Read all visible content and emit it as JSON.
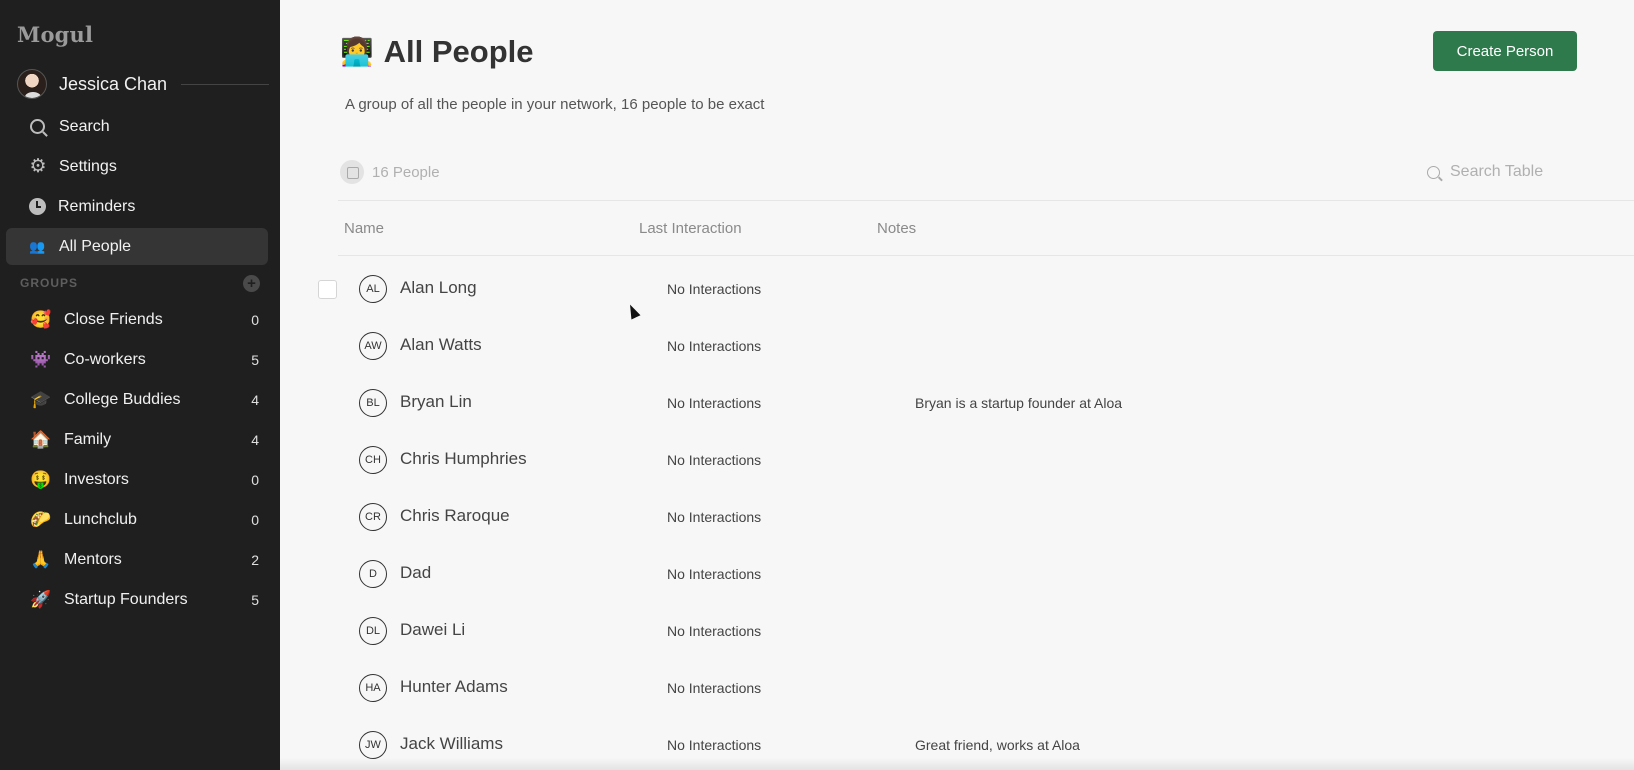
{
  "sidebar": {
    "brand": "Mogul",
    "user_name": "Jessica Chan",
    "nav": [
      {
        "label": "Search",
        "icon": "search-icon"
      },
      {
        "label": "Settings",
        "icon": "gear-icon"
      },
      {
        "label": "Reminders",
        "icon": "clock-icon"
      },
      {
        "label": "All People",
        "icon": "people-icon",
        "active": true
      }
    ],
    "groups_title": "GROUPS",
    "groups": [
      {
        "emoji": "🥰",
        "label": "Close Friends",
        "count": "0"
      },
      {
        "emoji": "👾",
        "label": "Co-workers",
        "count": "5"
      },
      {
        "emoji": "🎓",
        "label": "College Buddies",
        "count": "4"
      },
      {
        "emoji": "🏠",
        "label": "Family",
        "count": "4"
      },
      {
        "emoji": "🤑",
        "label": "Investors",
        "count": "0"
      },
      {
        "emoji": "🌮",
        "label": "Lunchclub",
        "count": "0"
      },
      {
        "emoji": "🙏",
        "label": "Mentors",
        "count": "2"
      },
      {
        "emoji": "🚀",
        "label": "Startup Founders",
        "count": "5"
      }
    ]
  },
  "main": {
    "title_emoji": "👩‍💻",
    "title": "All People",
    "description": "A group of all the people in your network, 16 people to be exact",
    "create_button": "Create Person",
    "count_label": "16 People",
    "search_placeholder": "Search Table",
    "columns": {
      "name": "Name",
      "last_interaction": "Last Interaction",
      "notes": "Notes"
    },
    "rows": [
      {
        "initials": "AL",
        "name": "Alan Long",
        "last_interaction": "No Interactions",
        "notes": ""
      },
      {
        "initials": "AW",
        "name": "Alan Watts",
        "last_interaction": "No Interactions",
        "notes": ""
      },
      {
        "initials": "BL",
        "name": "Bryan Lin",
        "last_interaction": "No Interactions",
        "notes": "Bryan is a startup founder at Aloa"
      },
      {
        "initials": "CH",
        "name": "Chris Humphries",
        "last_interaction": "No Interactions",
        "notes": ""
      },
      {
        "initials": "CR",
        "name": "Chris Raroque",
        "last_interaction": "No Interactions",
        "notes": ""
      },
      {
        "initials": "D",
        "name": "Dad",
        "last_interaction": "No Interactions",
        "notes": ""
      },
      {
        "initials": "DL",
        "name": "Dawei Li",
        "last_interaction": "No Interactions",
        "notes": ""
      },
      {
        "initials": "HA",
        "name": "Hunter Adams",
        "last_interaction": "No Interactions",
        "notes": ""
      },
      {
        "initials": "JW",
        "name": "Jack Williams",
        "last_interaction": "No Interactions",
        "notes": "Great friend, works at Aloa"
      }
    ]
  },
  "colors": {
    "sidebar_bg": "#1f1f1f",
    "accent": "#2f7a4d",
    "page_bg": "#f7f7f7"
  }
}
